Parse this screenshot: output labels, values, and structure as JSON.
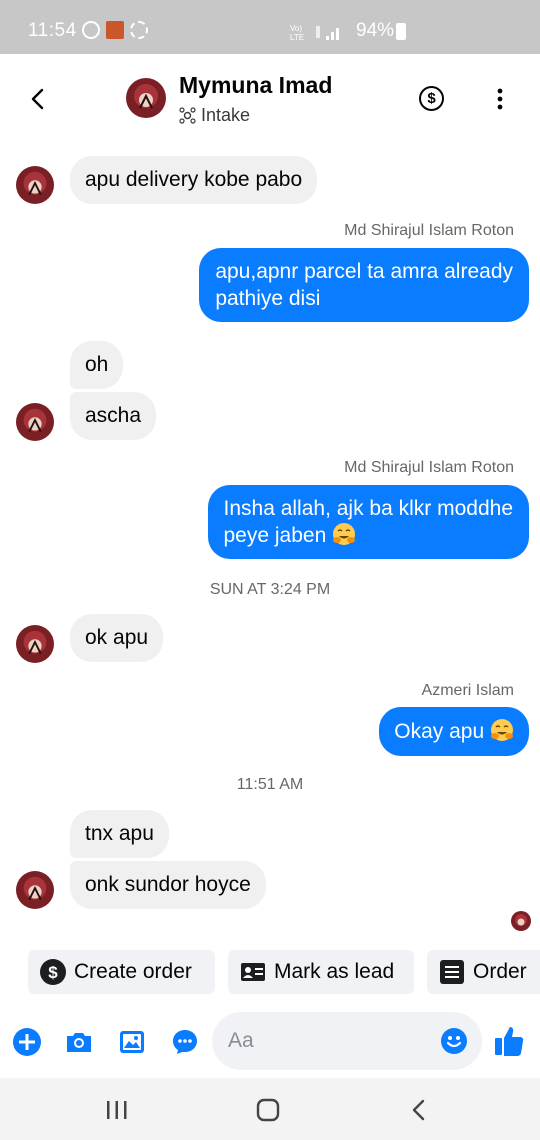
{
  "status_bar": {
    "time": "11:54",
    "battery": "94%",
    "network": "VoLTE"
  },
  "header": {
    "contact_name": "Mymuna Imad",
    "subtitle": "Intake",
    "icons": [
      "back-arrow-icon",
      "dollar-icon",
      "more-vertical-icon"
    ]
  },
  "messages": [
    {
      "direction": "in",
      "text": "apu delivery  kobe pabo"
    },
    {
      "direction": "out",
      "sender": "Md Shirajul Islam Roton",
      "lines": [
        "apu,apnr parcel ta amra already",
        "pathiye disi"
      ]
    },
    {
      "direction": "in",
      "text": "oh"
    },
    {
      "direction": "in",
      "text": "ascha"
    },
    {
      "direction": "out",
      "sender": "Md Shirajul Islam Roton",
      "lines": [
        "Insha allah, ajk ba klkr moddhe",
        "peye jaben"
      ],
      "emoji": "smiling-hug-emoji"
    },
    {
      "timestamp": "SUN AT 3:24 PM"
    },
    {
      "direction": "in",
      "text": "ok apu"
    },
    {
      "direction": "out",
      "sender": "Azmeri Islam",
      "text": "Okay apu",
      "emoji": "smiling-hug-emoji"
    },
    {
      "timestamp": "11:51 AM"
    },
    {
      "direction": "in",
      "text": "tnx  apu"
    },
    {
      "direction": "in",
      "text": "onk sundor hoyce"
    }
  ],
  "quick_actions": [
    {
      "label": "Create order",
      "icon": "dollar-circle-icon"
    },
    {
      "label": "Mark as lead",
      "icon": "contact-card-icon"
    },
    {
      "label": "Order",
      "icon": "list-icon"
    }
  ],
  "composer": {
    "placeholder": "Aa",
    "icons": [
      "plus-icon",
      "camera-icon",
      "photo-icon",
      "chat-bubble-icon",
      "emoji-icon",
      "thumbs-up-icon"
    ]
  },
  "colors": {
    "accent": "#0a7cff",
    "incoming_bubble": "#f0f0f0",
    "meta_text": "#65676b"
  }
}
